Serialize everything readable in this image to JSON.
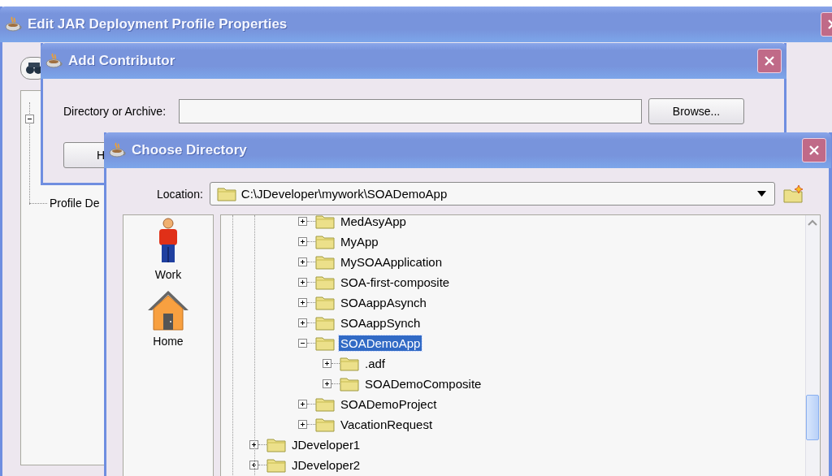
{
  "profile_window": {
    "title": "Edit JAR Deployment Profile Properties",
    "tree_item": "Profile De"
  },
  "contributor_dialog": {
    "title": "Add Contributor",
    "field_label": "Directory or Archive:",
    "browse_button": "Browse...",
    "help_button": "H"
  },
  "directory_dialog": {
    "title": "Choose Directory",
    "location_label": "Location:",
    "location_value": "C:\\JDeveloper\\mywork\\SOADemoApp",
    "places": [
      {
        "kind": "work",
        "label": "Work"
      },
      {
        "kind": "home",
        "label": "Home"
      }
    ],
    "tree": {
      "continued_children": [
        {
          "label": "MedAsyApp",
          "expanded": false,
          "selected": false
        },
        {
          "label": "MyApp",
          "expanded": false,
          "selected": false
        },
        {
          "label": "MySOAApplication",
          "expanded": false,
          "selected": false
        },
        {
          "label": "SOA-first-composite",
          "expanded": false,
          "selected": false
        },
        {
          "label": "SOAappAsynch",
          "expanded": false,
          "selected": false
        },
        {
          "label": "SOAappSynch",
          "expanded": false,
          "selected": false
        },
        {
          "label": "SOADemoApp",
          "expanded": true,
          "selected": true,
          "children": [
            {
              "label": ".adf",
              "expanded": false,
              "selected": false
            },
            {
              "label": "SOADemoComposite",
              "expanded": false,
              "selected": false
            }
          ]
        },
        {
          "label": "SOADemoProject",
          "expanded": false,
          "selected": false
        },
        {
          "label": "VacationRequest",
          "expanded": false,
          "selected": false
        }
      ],
      "items": [
        {
          "label": "JDeveloper1",
          "expanded": false,
          "selected": false
        },
        {
          "label": "JDeveloper2",
          "expanded": false,
          "selected": false
        }
      ]
    }
  }
}
